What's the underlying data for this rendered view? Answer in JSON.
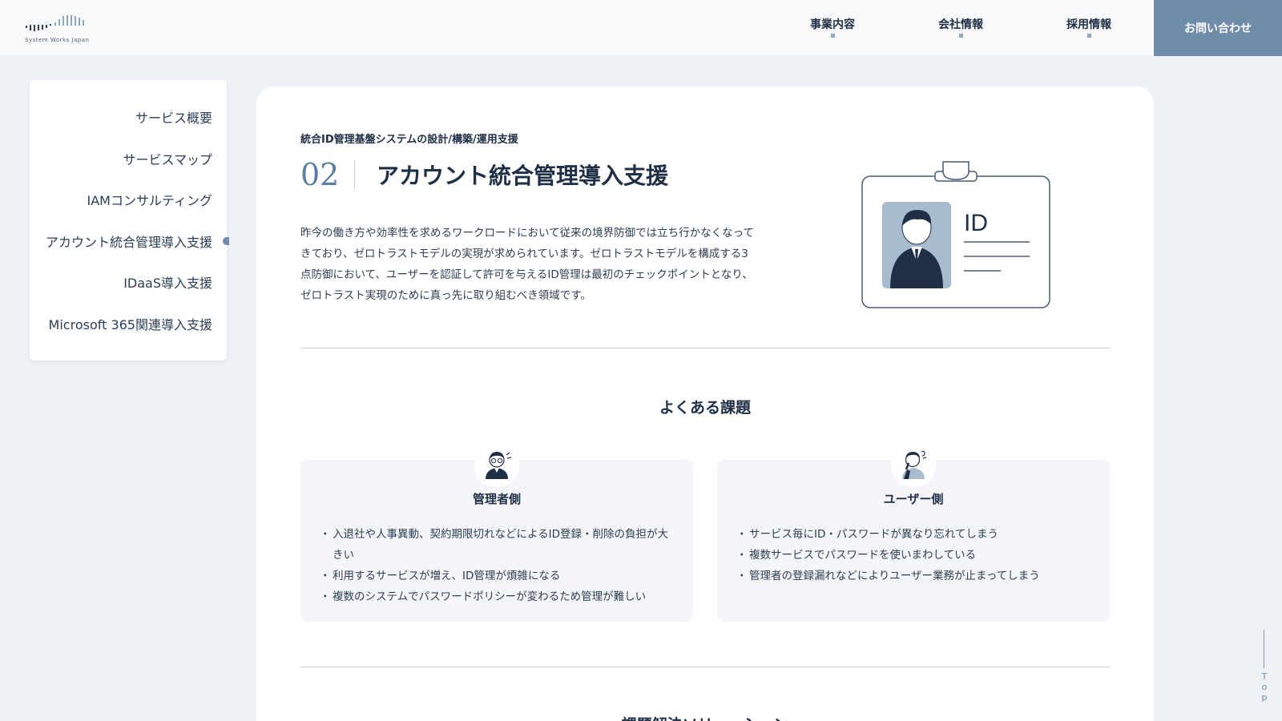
{
  "header": {
    "logo_text": "System Works Japan",
    "nav": [
      "事業内容",
      "会社情報",
      "採用情報"
    ],
    "contact_label": "お問い合わせ"
  },
  "sidebar": {
    "items": [
      {
        "label": "サービス概要"
      },
      {
        "label": "サービスマップ"
      },
      {
        "label": "IAMコンサルティング"
      },
      {
        "label": "アカウント統合管理導入支援"
      },
      {
        "label": "IDaaS導入支援"
      },
      {
        "label": "Microsoft 365関連導入支援"
      }
    ],
    "active_index": 3
  },
  "main": {
    "subtitle": "統合ID管理基盤システムの設計/構築/運用支援",
    "number": "02",
    "title": "アカウント統合管理導入支援",
    "description": "昨今の働き方や効率性を求めるワークロードにおいて従来の境界防御では立ち行かなくなってきており、ゼロトラストモデルの実現が求められています。ゼロトラストモデルを構成する3点防御において、ユーザーを認証して許可を与えるID管理は最初のチェックポイントとなり、ゼロトラスト実現のために真っ先に取り組むべき領域です。",
    "id_card_label": "ID",
    "issues_title": "よくある課題",
    "issues": [
      {
        "heading": "管理者側",
        "icon": "worried-admin-icon",
        "items": [
          "入退社や人事異動、契約期限切れなどによるID登録・削除の負担が大きい",
          "利用するサービスが増え、ID管理が煩雑になる",
          "複数のシステムでパスワードポリシーが変わるため管理が難しい"
        ]
      },
      {
        "heading": "ユーザー側",
        "icon": "confused-user-icon",
        "items": [
          "サービス毎にID・パスワードが異なり忘れてしまう",
          "複数サービスでパスワードを使いまわしている",
          "管理者の登録漏れなどによりユーザー業務が止まってしまう"
        ]
      }
    ],
    "next_section_title": "課題解決ソリューション"
  },
  "top_link": "Top",
  "colors": {
    "accent": "#6f8dab",
    "navy": "#1f2f45",
    "background": "#eef2f7"
  }
}
